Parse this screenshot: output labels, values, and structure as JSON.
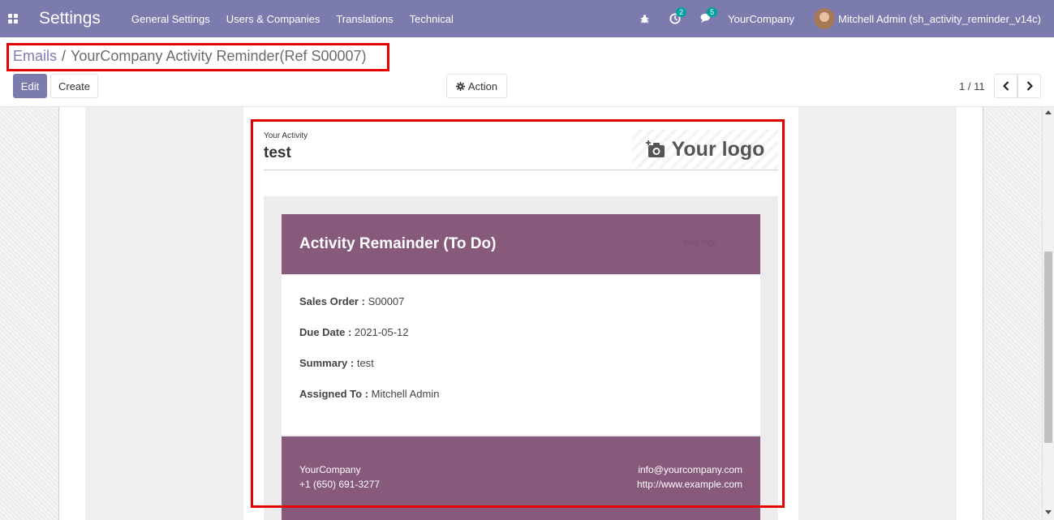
{
  "navbar": {
    "app_title": "Settings",
    "menu": [
      "General Settings",
      "Users & Companies",
      "Translations",
      "Technical"
    ],
    "activity_count": "2",
    "message_count": "5",
    "company": "YourCompany",
    "user": "Mitchell Admin (sh_activity_reminder_v14c)",
    "color": "#7c7bad"
  },
  "breadcrumb": {
    "parent": "Emails",
    "separator": "/",
    "current": "YourCompany Activity Reminder(Ref S00007)"
  },
  "toolbar": {
    "edit_label": "Edit",
    "create_label": "Create",
    "action_label": "Action"
  },
  "pager": {
    "text": "1 / 11"
  },
  "email": {
    "activity_label": "Your Activity",
    "activity_title": "test",
    "logo_text": "Your logo",
    "header_title": "Activity Remainder (To Do)",
    "header_logo_text": "Your logo",
    "fields": [
      {
        "label": "Sales Order :",
        "value": "S00007"
      },
      {
        "label": "Due Date :",
        "value": "2021-05-12"
      },
      {
        "label": "Summary :",
        "value": "test"
      },
      {
        "label": "Assigned To :",
        "value": "Mitchell Admin"
      }
    ],
    "footer": {
      "company": "YourCompany",
      "phone": "+1 (650) 691-3277",
      "email": "info@yourcompany.com",
      "website": "http://www.example.com"
    },
    "accent_color": "#875a7b"
  }
}
